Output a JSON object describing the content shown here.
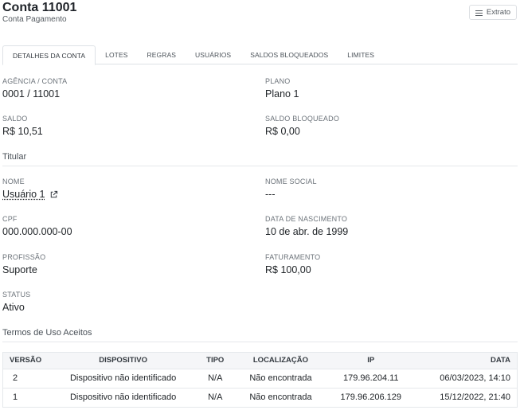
{
  "header": {
    "title": "Conta 11001",
    "subtitle": "Conta Pagamento",
    "extrato_label": "Extrato"
  },
  "tabs": [
    {
      "label": "DETALHES DA CONTA"
    },
    {
      "label": "LOTES"
    },
    {
      "label": "REGRAS"
    },
    {
      "label": "USUÁRIOS"
    },
    {
      "label": "SALDOS BLOQUEADOS"
    },
    {
      "label": "LIMITES"
    }
  ],
  "account": {
    "agencia_label": "AGÊNCIA / CONTA",
    "agencia_value": "0001 / 11001",
    "plano_label": "PLANO",
    "plano_value": "Plano 1",
    "saldo_label": "SALDO",
    "saldo_value": "R$ 10,51",
    "saldo_bloqueado_label": "SALDO BLOQUEADO",
    "saldo_bloqueado_value": "R$ 0,00"
  },
  "titular": {
    "section_title": "Titular",
    "nome_label": "NOME",
    "nome_value": "Usuário 1",
    "nome_social_label": "NOME SOCIAL",
    "nome_social_value": "---",
    "cpf_label": "CPF",
    "cpf_value": "000.000.000-00",
    "nascimento_label": "DATA DE NASCIMENTO",
    "nascimento_value": "10 de abr. de 1999",
    "profissao_label": "PROFISSÃO",
    "profissao_value": "Suporte",
    "faturamento_label": "FATURAMENTO",
    "faturamento_value": "R$ 100,00",
    "status_label": "STATUS",
    "status_value": "Ativo"
  },
  "termos": {
    "section_title": "Termos de Uso Aceitos",
    "columns": [
      "VERSÃO",
      "DISPOSITIVO",
      "TIPO",
      "LOCALIZAÇÃO",
      "IP",
      "DATA"
    ],
    "rows": [
      [
        "2",
        "Dispositivo não identificado",
        "N/A",
        "Não encontrada",
        "179.96.204.11",
        "06/03/2023, 14:10"
      ],
      [
        "1",
        "Dispositivo não identificado",
        "N/A",
        "Não encontrada",
        "179.96.206.129",
        "15/12/2022, 21:40"
      ]
    ]
  },
  "icons": {
    "extrato": "list-icon",
    "nome_link": "external-link-icon"
  }
}
